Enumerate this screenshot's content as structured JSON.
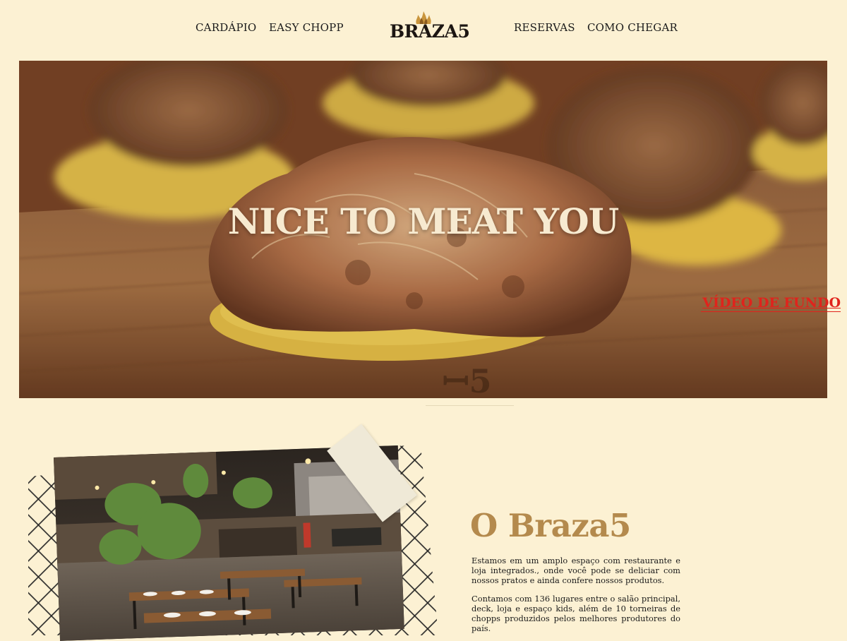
{
  "nav": {
    "menu_label": "CARDÁPIO",
    "chopp_label": "EASY CHOPP",
    "logo_text": "BRAZA5",
    "reservations_label": "RESERVAS",
    "directions_label": "COMO CHEGAR"
  },
  "hero": {
    "title": "NICE TO MEAT YOU",
    "video_link": "VÍDEO DE FUNDO"
  },
  "about": {
    "title": "O Braza5",
    "paragraph_1": "Estamos em um amplo espaço com restaurante e loja integrados., onde você pode se deliciar com nossos pratos e ainda confere nossos produtos.",
    "paragraph_2": "Contamos com 136 lugares entre o salão principal, deck, loja e espaço kids, além de 10 torneiras de chopps produzidos pelos melhores produtores do país."
  },
  "colors": {
    "background": "#fcf1d3",
    "accent_gold": "#b48a4d",
    "link_red": "#e0231c",
    "hero_text": "#f7ead0"
  }
}
